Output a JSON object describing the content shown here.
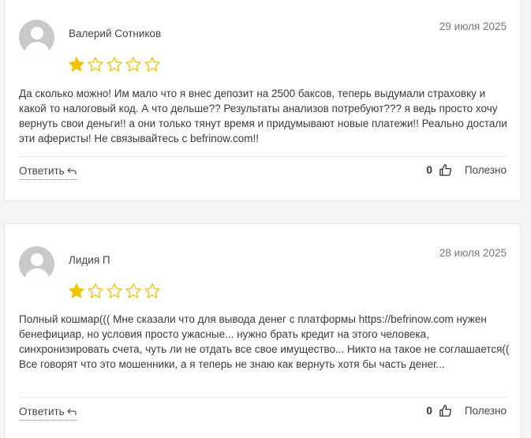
{
  "reviews": [
    {
      "author": "Валерий Сотников",
      "date": "29 июля 2025",
      "rating": 1,
      "max_rating": 5,
      "text": "Да сколько можно! Им мало что я внес депозит на 2500 баксов, теперь выдумали страховку и какой то налоговый код. А что дельше?? Результаты анализов потребуют??? я ведь просто хочу вернуть свои деньги!! а они только тянут время и придумывают новые платежи!! Реально достали эти аферисты! Не связывайтесь с befrinow.com!!",
      "reply_label": "Ответить",
      "votes": "0",
      "useful_label": "Полезно"
    },
    {
      "author": "Лидия П",
      "date": "28 июля 2025",
      "rating": 1,
      "max_rating": 5,
      "text": "Полный кошмар((( Мне сказали что для вывода денег с платформы https://befrinow.com нужен бенефициар, но условия просто ужасные... нужно брать кредит на этого человека, синхронизировать счета, чуть ли не отдать все свое имущество... Никто на такое не соглашается(( Все говорят что это мошенники, а я теперь не знаю как вернуть хотя бы часть денег...",
      "reply_label": "Ответить",
      "votes": "0",
      "useful_label": "Полезно"
    }
  ],
  "colors": {
    "star_filled": "#f2c200",
    "star_outline": "#f2c200",
    "avatar_bg": "#c9c9c9"
  }
}
